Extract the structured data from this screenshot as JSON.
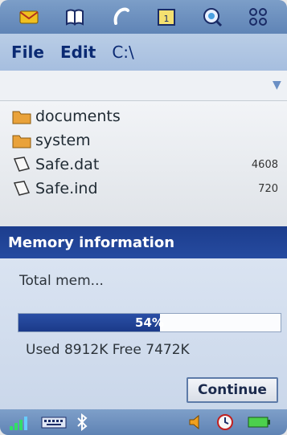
{
  "topbar": {
    "icons": [
      "messaging-icon",
      "contacts-book-icon",
      "phone-icon",
      "calendar-icon",
      "web-browser-icon",
      "applications-grid-icon"
    ]
  },
  "menu": {
    "file": "File",
    "edit": "Edit",
    "path": "C:\\"
  },
  "files": [
    {
      "name": "documents",
      "type": "folder",
      "size": ""
    },
    {
      "name": "system",
      "type": "folder",
      "size": ""
    },
    {
      "name": "Safe.dat",
      "type": "file",
      "size": "4608"
    },
    {
      "name": "Safe.ind",
      "type": "file",
      "size": "720"
    }
  ],
  "dialog": {
    "title": "Memory information",
    "message": "Total mem...",
    "progress_label": "54%",
    "progress_value": 0.54,
    "usage": "Used 8912K Free 7472K",
    "continue_label": "Continue"
  },
  "statusbar": {
    "icons": [
      "signal-strength-icon",
      "keyboard-icon",
      "bluetooth-icon",
      "speaker-icon",
      "clock-icon",
      "battery-icon"
    ]
  },
  "colors": {
    "accent": "#1c3d8d",
    "menu_text": "#0b2a73",
    "bar": "#6f93c2"
  }
}
